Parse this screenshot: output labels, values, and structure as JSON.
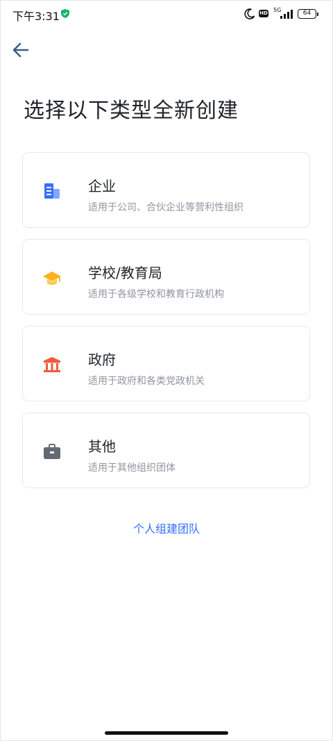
{
  "status_bar": {
    "time": "下午3:31",
    "network_label": "5G",
    "battery_level": "64"
  },
  "page": {
    "title": "选择以下类型全新创建"
  },
  "options": [
    {
      "title": "企业",
      "description": "适用于公司、合伙企业等营利性组织",
      "icon": "building-icon",
      "color": "#3370ff"
    },
    {
      "title": "学校/教育局",
      "description": "适用于各级学校和教育行政机构",
      "icon": "graduation-cap-icon",
      "color": "#ffb11b"
    },
    {
      "title": "政府",
      "description": "适用于政府和各类党政机关",
      "icon": "government-building-icon",
      "color": "#f05b3d"
    },
    {
      "title": "其他",
      "description": "适用于其他组织团体",
      "icon": "briefcase-icon",
      "color": "#646a73"
    }
  ],
  "footer": {
    "personal_team_link": "个人组建团队"
  }
}
